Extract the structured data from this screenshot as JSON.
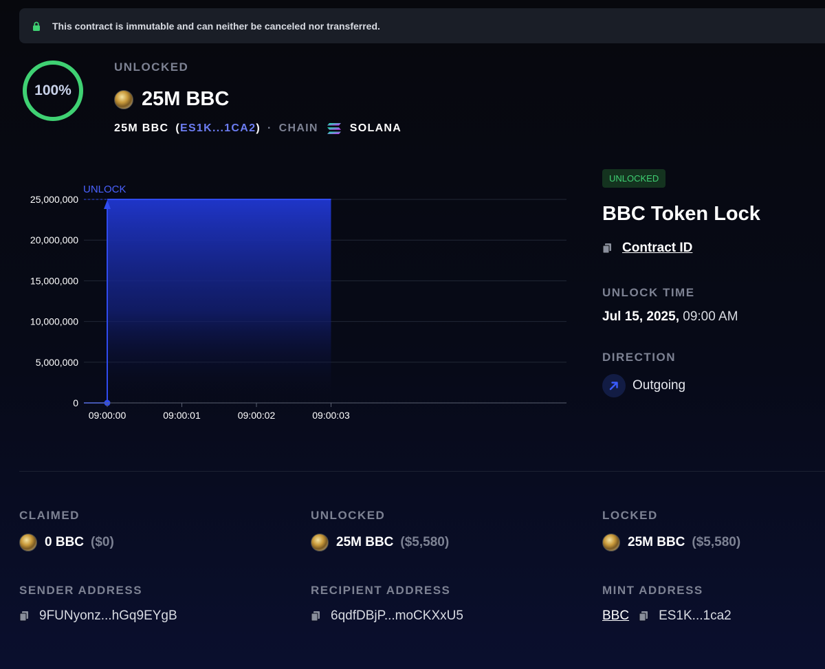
{
  "banner": {
    "text": "This contract is immutable and can neither be canceled nor transferred."
  },
  "header": {
    "progress_text": "100%",
    "progress": 1.0,
    "status_label": "UNLOCKED",
    "amount": "25M BBC",
    "token_amount": "25M BBC",
    "token_address": "ES1K...1CA2",
    "chain_label": "CHAIN",
    "chain_name": "SOLANA"
  },
  "chart_data": {
    "type": "area",
    "marker_label": "UNLOCK",
    "x": [
      "09:00:00",
      "09:00:01",
      "09:00:02",
      "09:00:03"
    ],
    "y": [
      25000000,
      25000000,
      25000000,
      25000000
    ],
    "y_ticks": [
      "25,000,000",
      "20,000,000",
      "15,000,000",
      "10,000,000",
      "5,000,000",
      "0"
    ],
    "ylim": [
      0,
      25000000
    ],
    "grid": true,
    "colors": {
      "line": "#2f4bf0",
      "fill_top": "#1f35c8",
      "grid": "#222836"
    }
  },
  "panel": {
    "badge": "UNLOCKED",
    "title": "BBC Token Lock",
    "contract_id_label": "Contract ID",
    "unlock_time_label": "UNLOCK TIME",
    "unlock_date": "Jul 15, 2025,",
    "unlock_time": "09:00 AM",
    "direction_label": "DIRECTION",
    "direction": "Outgoing"
  },
  "stats": {
    "claimed": {
      "label": "CLAIMED",
      "amount": "0 BBC",
      "usd": "($0)"
    },
    "unlocked": {
      "label": "UNLOCKED",
      "amount": "25M BBC",
      "usd": "($5,580)"
    },
    "locked": {
      "label": "LOCKED",
      "amount": "25M BBC",
      "usd": "($5,580)"
    }
  },
  "addresses": {
    "sender": {
      "label": "SENDER ADDRESS",
      "value": "9FUNyonz...hGq9EYgB"
    },
    "recipient": {
      "label": "RECIPIENT ADDRESS",
      "value": "6qdfDBjP...moCKXxU5"
    },
    "mint": {
      "label": "MINT ADDRESS",
      "link": "BBC",
      "value": "ES1K...1ca2"
    }
  },
  "colors": {
    "accent": "#2f4bf0",
    "success": "#3fd173",
    "muted": "#7d8293"
  }
}
